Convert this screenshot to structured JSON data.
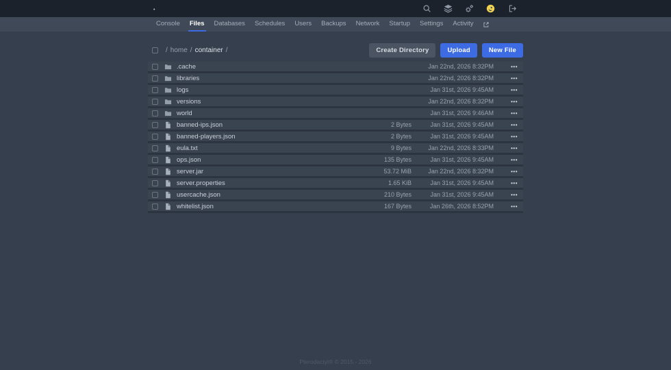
{
  "colors": {
    "accent_blue": "#3D6BE4",
    "topbar_bg": "#1B222C",
    "navbar_bg": "#404957",
    "page_bg": "#353F4D",
    "row_bg": "#3A4350",
    "avatar_yellow": "#EFD34F"
  },
  "topbar": {
    "brand_dot": "•",
    "icons": [
      "search-icon",
      "servers-icon",
      "admin-cogs-icon",
      "user-avatar",
      "sign-out-icon"
    ]
  },
  "nav": {
    "active_tab": "Files",
    "tabs": [
      {
        "label": "Console"
      },
      {
        "label": "Files"
      },
      {
        "label": "Databases"
      },
      {
        "label": "Schedules"
      },
      {
        "label": "Users"
      },
      {
        "label": "Backups"
      },
      {
        "label": "Network"
      },
      {
        "label": "Startup"
      },
      {
        "label": "Settings"
      },
      {
        "label": "Activity"
      }
    ],
    "external_link_icon": "external-link-icon"
  },
  "toolbar": {
    "breadcrumb": {
      "sep": "/",
      "segments": [
        "home",
        "container"
      ]
    },
    "buttons": {
      "create_directory": "Create Directory",
      "upload": "Upload",
      "new_file": "New File"
    }
  },
  "files": {
    "menu_glyph": "•••",
    "rows": [
      {
        "name": ".cache",
        "type": "folder",
        "size": "",
        "modified": "Jan 22nd, 2026 8:32PM"
      },
      {
        "name": "libraries",
        "type": "folder",
        "size": "",
        "modified": "Jan 22nd, 2026 8:32PM"
      },
      {
        "name": "logs",
        "type": "folder",
        "size": "",
        "modified": "Jan 31st, 2026 9:45AM"
      },
      {
        "name": "versions",
        "type": "folder",
        "size": "",
        "modified": "Jan 22nd, 2026 8:32PM"
      },
      {
        "name": "world",
        "type": "folder",
        "size": "",
        "modified": "Jan 31st, 2026 9:46AM"
      },
      {
        "name": "banned-ips.json",
        "type": "file",
        "size": "2 Bytes",
        "modified": "Jan 31st, 2026 9:45AM"
      },
      {
        "name": "banned-players.json",
        "type": "file",
        "size": "2 Bytes",
        "modified": "Jan 31st, 2026 9:45AM"
      },
      {
        "name": "eula.txt",
        "type": "file",
        "size": "9 Bytes",
        "modified": "Jan 22nd, 2026 8:33PM"
      },
      {
        "name": "ops.json",
        "type": "file",
        "size": "135 Bytes",
        "modified": "Jan 31st, 2026 9:45AM"
      },
      {
        "name": "server.jar",
        "type": "file",
        "size": "53.72 MiB",
        "modified": "Jan 22nd, 2026 8:32PM"
      },
      {
        "name": "server.properties",
        "type": "file",
        "size": "1.65 KiB",
        "modified": "Jan 31st, 2026 9:45AM"
      },
      {
        "name": "usercache.json",
        "type": "file",
        "size": "210 Bytes",
        "modified": "Jan 31st, 2026 9:45AM"
      },
      {
        "name": "whitelist.json",
        "type": "file",
        "size": "167 Bytes",
        "modified": "Jan 26th, 2026 8:52PM"
      }
    ]
  },
  "footer": {
    "copyright": "Pterodactyl® © 2015 - 2026"
  }
}
